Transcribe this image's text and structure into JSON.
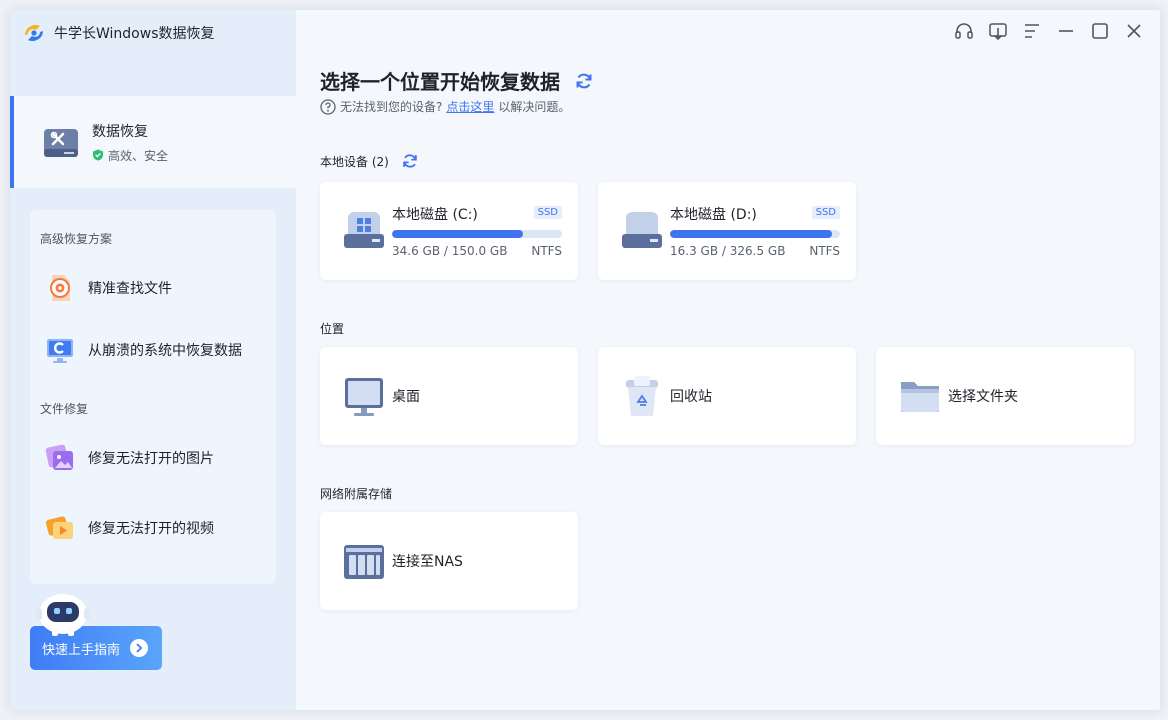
{
  "app": {
    "title": "牛学长Windows数据恢复"
  },
  "sidebar": {
    "active": {
      "title": "数据恢复",
      "subtitle": "高效、安全"
    },
    "advanced_label": "高级恢复方案",
    "advanced_items": [
      {
        "label": "精准查找文件",
        "icon": "target-file-icon"
      },
      {
        "label": "从崩溃的系统中恢复数据",
        "icon": "crashed-system-icon"
      }
    ],
    "repair_label": "文件修复",
    "repair_items": [
      {
        "label": "修复无法打开的图片",
        "icon": "photo-repair-icon"
      },
      {
        "label": "修复无法打开的视频",
        "icon": "video-repair-icon"
      }
    ],
    "guide_button": "快速上手指南"
  },
  "main": {
    "title": "选择一个位置开始恢复数据",
    "help_text": "无法找到您的设备?",
    "help_link": "点击这里",
    "help_suffix": "以解决问题。",
    "local_label": "本地设备 (2)",
    "disks": [
      {
        "name": "本地磁盘 (C:)",
        "badge": "SSD",
        "size": "34.6 GB / 150.0 GB",
        "fs": "NTFS",
        "used_fraction": 0.77
      },
      {
        "name": "本地磁盘 (D:)",
        "badge": "SSD",
        "size": "16.3 GB / 326.5 GB",
        "fs": "NTFS",
        "used_fraction": 0.95
      }
    ],
    "location_label": "位置",
    "locations": [
      {
        "label": "桌面",
        "icon": "desktop-monitor-icon"
      },
      {
        "label": "回收站",
        "icon": "recycle-bin-icon"
      },
      {
        "label": "选择文件夹",
        "icon": "folder-icon"
      }
    ],
    "nas_label": "网络附属存储",
    "nas": {
      "label": "连接至NAS",
      "icon": "nas-icon"
    }
  },
  "colors": {
    "accent": "#3f74f0",
    "sidebar_bg": "#e4eefb",
    "main_bg": "#f4f7fc"
  }
}
